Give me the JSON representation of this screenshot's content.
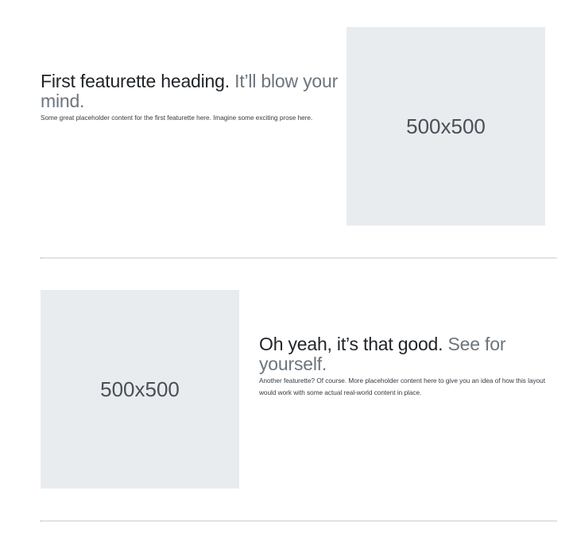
{
  "featurettes": [
    {
      "heading": "First featurette heading.",
      "heading_muted": "It’ll blow your mind.",
      "lead": "Some great placeholder content for the first featurette here. Imagine some exciting prose here.",
      "image_label": "500x500"
    },
    {
      "heading": "Oh yeah, it’s that good.",
      "heading_muted": "See for yourself.",
      "lead": "Another featurette? Of course. More placeholder content here to give you an idea of how this layout would work with some actual real-world content in place.",
      "image_label": "500x500"
    }
  ],
  "colors": {
    "placeholder_bg": "#e9ecef",
    "muted_text": "#6c757d",
    "divider": "#d6d8db"
  }
}
